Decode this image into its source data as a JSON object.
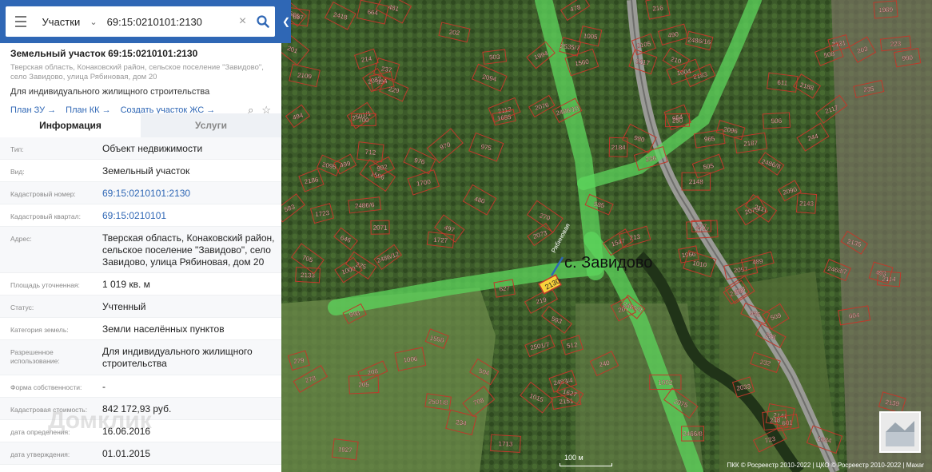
{
  "search": {
    "layer": "Участки",
    "query": "69:15:0210101:2130"
  },
  "parcel": {
    "title": "Земельный участок 69:15:0210101:2130",
    "address": "Тверская область, Конаковский район, сельское поселение \"Завидово\", село Завидово, улица Рябиновая, дом 20",
    "use": "Для индивидуального жилищного строительства",
    "links": [
      "План ЗУ",
      "План КК",
      "Создать участок ЖС"
    ]
  },
  "tabs": [
    "Информация",
    "Услуги"
  ],
  "info": [
    {
      "label": "Тип:",
      "value": "Объект недвижимости"
    },
    {
      "label": "Вид:",
      "value": "Земельный участок"
    },
    {
      "label": "Кадастровый номер:",
      "value": "69:15:0210101:2130"
    },
    {
      "label": "Кадастровый квартал:",
      "value": "69:15:0210101"
    },
    {
      "label": "Адрес:",
      "value": "Тверская область, Конаковский район, сельское поселение \"Завидово\", село Завидово, улица Рябиновая, дом 20"
    },
    {
      "label": "Площадь уточненная:",
      "value": "1 019 кв. м"
    },
    {
      "label": "Статус:",
      "value": "Учтенный"
    },
    {
      "label": "Категория земель:",
      "value": "Земли населённых пунктов"
    },
    {
      "label": "Разрешенное использование:",
      "value": "Для индивидуального жилищного строительства"
    },
    {
      "label": "Форма собственности:",
      "value": "-"
    },
    {
      "label": "Кадастровая стоимость:",
      "value": "842 172,93 руб."
    },
    {
      "label": "дата определения:",
      "value": "16.06.2016"
    },
    {
      "label": "дата утверждения:",
      "value": "01.01.2015"
    }
  ],
  "watermark": "Домклик",
  "map": {
    "place_label": "с. Завидово",
    "highlight_parcel": "2130",
    "street_label": "Рябиновая",
    "scale": "100 м",
    "attribution": "ПКК © Росреестр 2010-2022 | ЦКО © Росреестр 2010-2022 | Maxar",
    "parcel_numbers": [
      "2501/1",
      "2468/7",
      "2486/16",
      "2486/12",
      "2486/6",
      "2486/9",
      "2486/10",
      "2486/8",
      "2501/8",
      "2501/7",
      "2535/7",
      "2466/8",
      "2483/4",
      "1558",
      "1684",
      "1966",
      "1700",
      "1989",
      "1927",
      "1560",
      "2109",
      "2117",
      "2418",
      "2071",
      "2095",
      "2082",
      "1994",
      "2111",
      "2113",
      "2131",
      "2133",
      "2135",
      "2137",
      "2139",
      "2141",
      "2143",
      "2148",
      "2151",
      "2183",
      "2184",
      "2186",
      "2187",
      "2188",
      "2105",
      "2073",
      "2079",
      "2076",
      "2033",
      "2112",
      "2075",
      "2090",
      "2097",
      "2094",
      "2096",
      "2114",
      "2117",
      "1547",
      "1596",
      "1627",
      "1655",
      "1713",
      "1723",
      "1727",
      "477",
      "478",
      "480",
      "481",
      "489",
      "490",
      "493",
      "494",
      "497",
      "499",
      "503",
      "504",
      "505",
      "506",
      "508",
      "509",
      "512",
      "583",
      "585",
      "593",
      "601",
      "604",
      "611",
      "627",
      "646",
      "654",
      "663",
      "664",
      "665",
      "697",
      "700",
      "705",
      "708",
      "712",
      "723",
      "965",
      "970",
      "975",
      "976",
      "980",
      "985",
      "990",
      "992",
      "994",
      "998",
      "1000",
      "1002",
      "1004",
      "1005",
      "1006",
      "1010",
      "1015",
      "201",
      "202",
      "203",
      "205",
      "207",
      "208",
      "210",
      "213",
      "214",
      "216",
      "219",
      "223",
      "225",
      "229",
      "232",
      "234",
      "235",
      "236",
      "237",
      "238",
      "240",
      "244",
      "248",
      "250",
      "270",
      "278",
      "279"
    ],
    "legend_color_parcel": "#c0392b",
    "legend_color_zone": "#5cd65c"
  }
}
